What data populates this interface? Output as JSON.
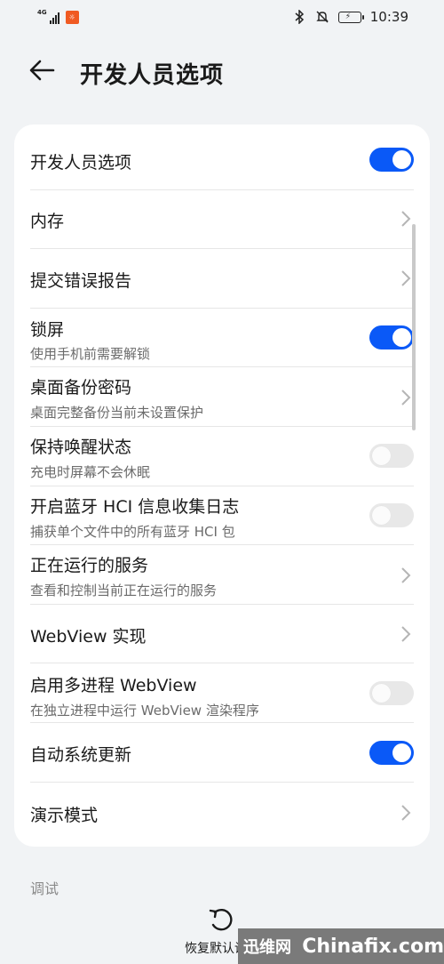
{
  "status_bar": {
    "network": "4G",
    "time": "10:39"
  },
  "header": {
    "title": "开发人员选项"
  },
  "settings": [
    {
      "title": "开发人员选项",
      "subtitle": "",
      "control": "switch",
      "on": true
    },
    {
      "title": "内存",
      "subtitle": "",
      "control": "chevron"
    },
    {
      "title": "提交错误报告",
      "subtitle": "",
      "control": "chevron"
    },
    {
      "title": "锁屏",
      "subtitle": "使用手机前需要解锁",
      "control": "switch",
      "on": true
    },
    {
      "title": "桌面备份密码",
      "subtitle": "桌面完整备份当前未设置保护",
      "control": "chevron"
    },
    {
      "title": "保持唤醒状态",
      "subtitle": "充电时屏幕不会休眠",
      "control": "switch",
      "on": false
    },
    {
      "title": "开启蓝牙 HCI 信息收集日志",
      "subtitle": "捕获单个文件中的所有蓝牙 HCI 包",
      "control": "switch",
      "on": false
    },
    {
      "title": "正在运行的服务",
      "subtitle": "查看和控制当前正在运行的服务",
      "control": "chevron"
    },
    {
      "title": "WebView 实现",
      "subtitle": "",
      "control": "chevron"
    },
    {
      "title": "启用多进程 WebView",
      "subtitle": "在独立进程中运行 WebView 渲染程序",
      "control": "switch",
      "on": false
    },
    {
      "title": "自动系统更新",
      "subtitle": "",
      "control": "switch",
      "on": true
    },
    {
      "title": "演示模式",
      "subtitle": "",
      "control": "chevron"
    }
  ],
  "section": {
    "label": "调试"
  },
  "bottom_action": {
    "label": "恢复默认设置"
  },
  "watermark": {
    "cn": "迅维网",
    "en": "Chinafix.com"
  },
  "colors": {
    "accent": "#0a59f7",
    "background": "#f1f3f5",
    "card": "#ffffff"
  }
}
